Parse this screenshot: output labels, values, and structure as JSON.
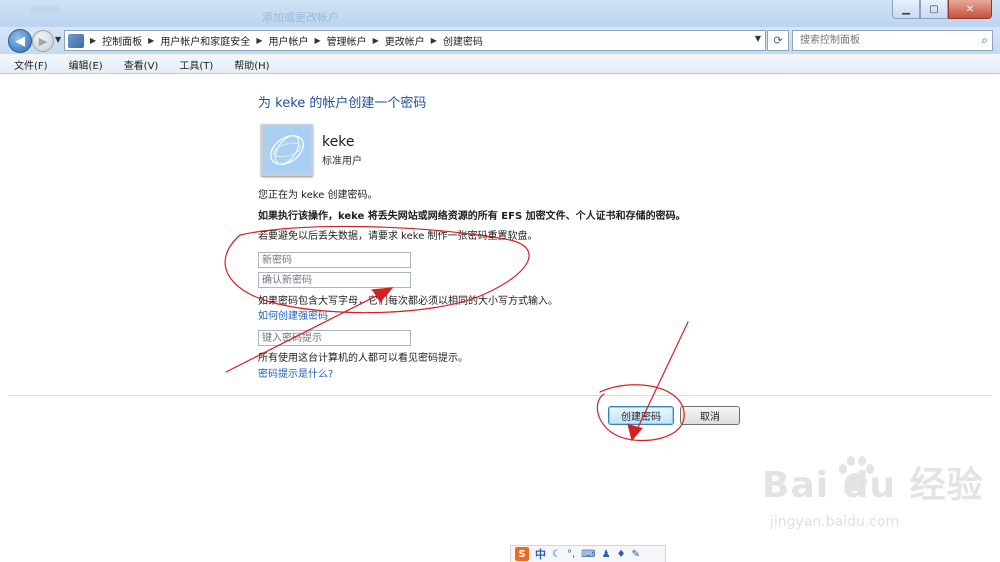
{
  "window": {
    "title_ghost": "添加或更改帐户"
  },
  "nav": {
    "breadcrumbs": [
      "控制面板",
      "用户帐户和家庭安全",
      "用户帐户",
      "管理帐户",
      "更改帐户",
      "创建密码"
    ],
    "search_placeholder": "搜索控制面板",
    "icons": [
      "back-arrow-icon",
      "forward-arrow-icon",
      "refresh-icon",
      "search-icon"
    ]
  },
  "menu": [
    "文件(F)",
    "编辑(E)",
    "查看(V)",
    "工具(T)",
    "帮助(H)"
  ],
  "page": {
    "title": "为 keke 的帐户创建一个密码",
    "user_name": "keke",
    "user_type": "标准用户",
    "info1": "您正在为 keke 创建密码。",
    "info2": "如果执行该操作，keke 将丢失网站或网络资源的所有 EFS 加密文件、个人证书和存储的密码。",
    "info3": "若要避免以后丢失数据，请要求 keke 制作一张密码重置软盘。",
    "new_password_placeholder": "新密码",
    "confirm_password_placeholder": "确认新密码",
    "case_hint": "如果密码包含大写字母，它们每次都必须以相同的大小写方式输入。",
    "strong_password_link": "如何创建强密码",
    "password_hint_placeholder": "键入密码提示",
    "hint_visible": "所有使用这台计算机的人都可以看见密码提示。",
    "hint_link": "密码提示是什么?",
    "create_button": "创建密码",
    "cancel_button": "取消"
  },
  "watermark": {
    "brand": "Bai  du 经验",
    "url": "jingyan.baidu.com"
  },
  "ime": {
    "logo": "S",
    "mode": "中"
  },
  "annotation_color": "#d42020"
}
